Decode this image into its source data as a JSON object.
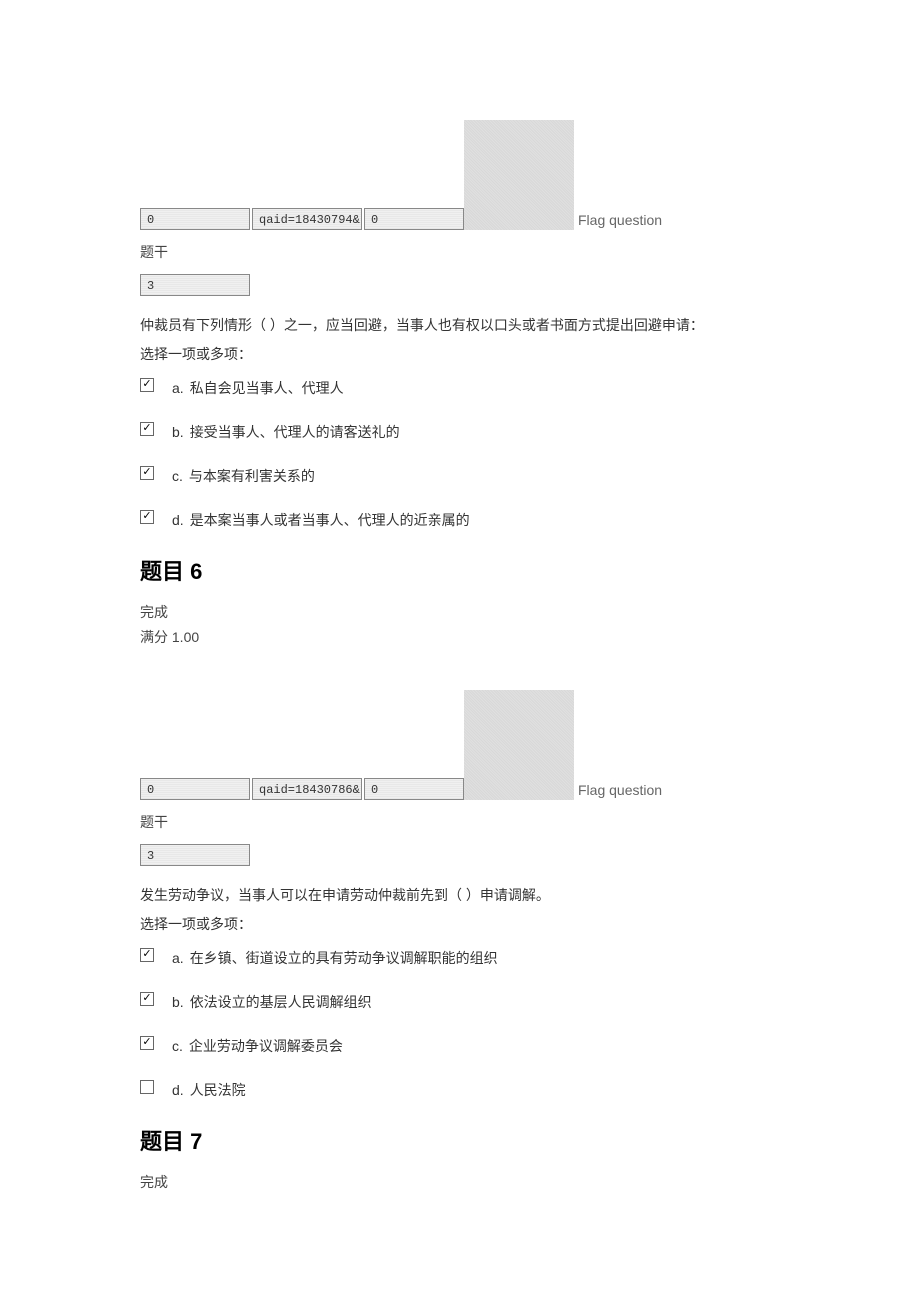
{
  "q5": {
    "flag_inputs": {
      "i1": "0",
      "i2": "qaid=18430794&",
      "i3": "0"
    },
    "flag_label": "Flag question",
    "stem_label": "题干",
    "stem_input": "3",
    "question_text": "仲裁员有下列情形（ ）之一，应当回避，当事人也有权以口头或者书面方式提出回避申请：",
    "instruction": "选择一项或多项：",
    "options": [
      {
        "letter": "a.",
        "text": "私自会见当事人、代理人",
        "checked": true
      },
      {
        "letter": "b.",
        "text": "接受当事人、代理人的请客送礼的",
        "checked": true
      },
      {
        "letter": "c.",
        "text": "与本案有利害关系的",
        "checked": true
      },
      {
        "letter": "d.",
        "text": "是本案当事人或者当事人、代理人的近亲属的",
        "checked": true
      }
    ]
  },
  "q6": {
    "heading": "题目 6",
    "status_done": "完成",
    "status_score": "满分 1.00",
    "flag_inputs": {
      "i1": "0",
      "i2": "qaid=18430786&",
      "i3": "0"
    },
    "flag_label": "Flag question",
    "stem_label": "题干",
    "stem_input": "3",
    "question_text": "发生劳动争议，当事人可以在申请劳动仲裁前先到（ ）申请调解。",
    "instruction": "选择一项或多项：",
    "options": [
      {
        "letter": "a.",
        "text": "在乡镇、街道设立的具有劳动争议调解职能的组织",
        "checked": true
      },
      {
        "letter": "b.",
        "text": "依法设立的基层人民调解组织",
        "checked": true
      },
      {
        "letter": "c.",
        "text": "企业劳动争议调解委员会",
        "checked": true
      },
      {
        "letter": "d.",
        "text": "人民法院",
        "checked": false
      }
    ]
  },
  "q7": {
    "heading": "题目 7",
    "status_done": "完成"
  }
}
